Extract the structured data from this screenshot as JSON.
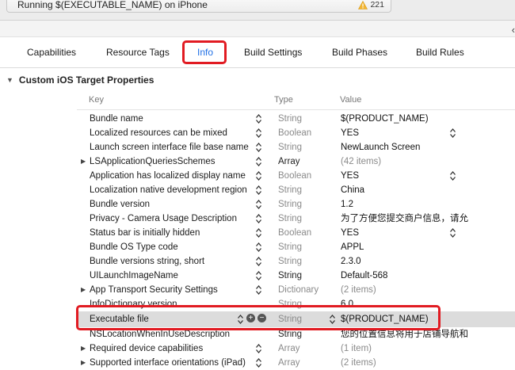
{
  "activity": {
    "text": "Running $(EXECUTABLE_NAME) on iPhone",
    "warning_count": "221"
  },
  "tabs": [
    {
      "label": "Capabilities",
      "active": false
    },
    {
      "label": "Resource Tags",
      "active": false
    },
    {
      "label": "Info",
      "active": true
    },
    {
      "label": "Build Settings",
      "active": false
    },
    {
      "label": "Build Phases",
      "active": false
    },
    {
      "label": "Build Rules",
      "active": false
    }
  ],
  "section": {
    "title": "Custom iOS Target Properties"
  },
  "columns": {
    "key": "Key",
    "type": "Type",
    "value": "Value"
  },
  "rows": [
    {
      "key": "Bundle name",
      "type": "String",
      "value": "$(PRODUCT_NAME)"
    },
    {
      "key": "Localized resources can be mixed",
      "type": "Boolean",
      "value": "YES"
    },
    {
      "key": "Launch screen interface file base name",
      "type": "String",
      "value": "NewLaunch Screen"
    },
    {
      "key": "LSApplicationQueriesSchemes",
      "type": "Array",
      "value": "(42 items)"
    },
    {
      "key": "Application has localized display name",
      "type": "Boolean",
      "value": "YES"
    },
    {
      "key": "Localization native development region",
      "type": "String",
      "value": "China"
    },
    {
      "key": "Bundle version",
      "type": "String",
      "value": "1.2"
    },
    {
      "key": "Privacy - Camera Usage Description",
      "type": "String",
      "value": "为了方便您提交商户信息，请允"
    },
    {
      "key": "Status bar is initially hidden",
      "type": "Boolean",
      "value": "YES"
    },
    {
      "key": "Bundle OS Type code",
      "type": "String",
      "value": "APPL"
    },
    {
      "key": "Bundle versions string, short",
      "type": "String",
      "value": "2.3.0"
    },
    {
      "key": "UILaunchImageName",
      "type": "String",
      "value": "Default-568"
    },
    {
      "key": "App Transport Security Settings",
      "type": "Dictionary",
      "value": "(2 items)"
    },
    {
      "key": "InfoDictionary version",
      "type": "String",
      "value": "6.0"
    },
    {
      "key": "Executable file",
      "type": "String",
      "value": "$(PRODUCT_NAME)"
    },
    {
      "key": "NSLocationWhenInUseDescription",
      "type": "String",
      "value": "您的位置信息将用于店铺导航和"
    },
    {
      "key": "Required device capabilities",
      "type": "Array",
      "value": "(1 item)"
    },
    {
      "key": "Supported interface orientations (iPad)",
      "type": "Array",
      "value": "(2 items)"
    }
  ]
}
